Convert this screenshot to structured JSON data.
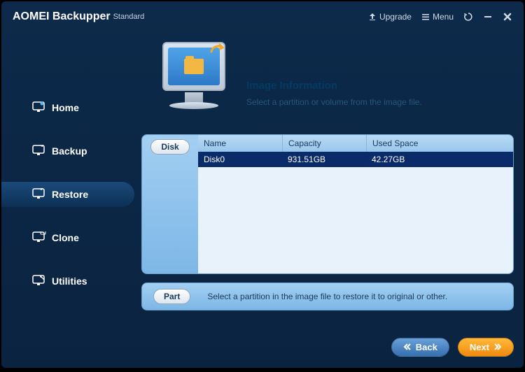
{
  "app": {
    "title": "AOMEI Backupper",
    "edition": "Standard"
  },
  "titlebar": {
    "upgrade": "Upgrade",
    "menu": "Menu"
  },
  "nav": {
    "items": [
      {
        "label": "Home"
      },
      {
        "label": "Backup"
      },
      {
        "label": "Restore"
      },
      {
        "label": "Clone"
      },
      {
        "label": "Utilities"
      }
    ]
  },
  "header": {
    "title": "Image Information",
    "subtitle": "Select a partition or volume from the image file."
  },
  "disk_pill": "Disk",
  "columns": {
    "name": "Name",
    "capacity": "Capacity",
    "used": "Used Space"
  },
  "rows": [
    {
      "name": "Disk0",
      "capacity": "931.51GB",
      "used": "42.27GB"
    }
  ],
  "part_pill": "Part",
  "part_text": "Select a partition in the image file to restore it to original or other.",
  "buttons": {
    "back": "Back",
    "next": "Next"
  }
}
